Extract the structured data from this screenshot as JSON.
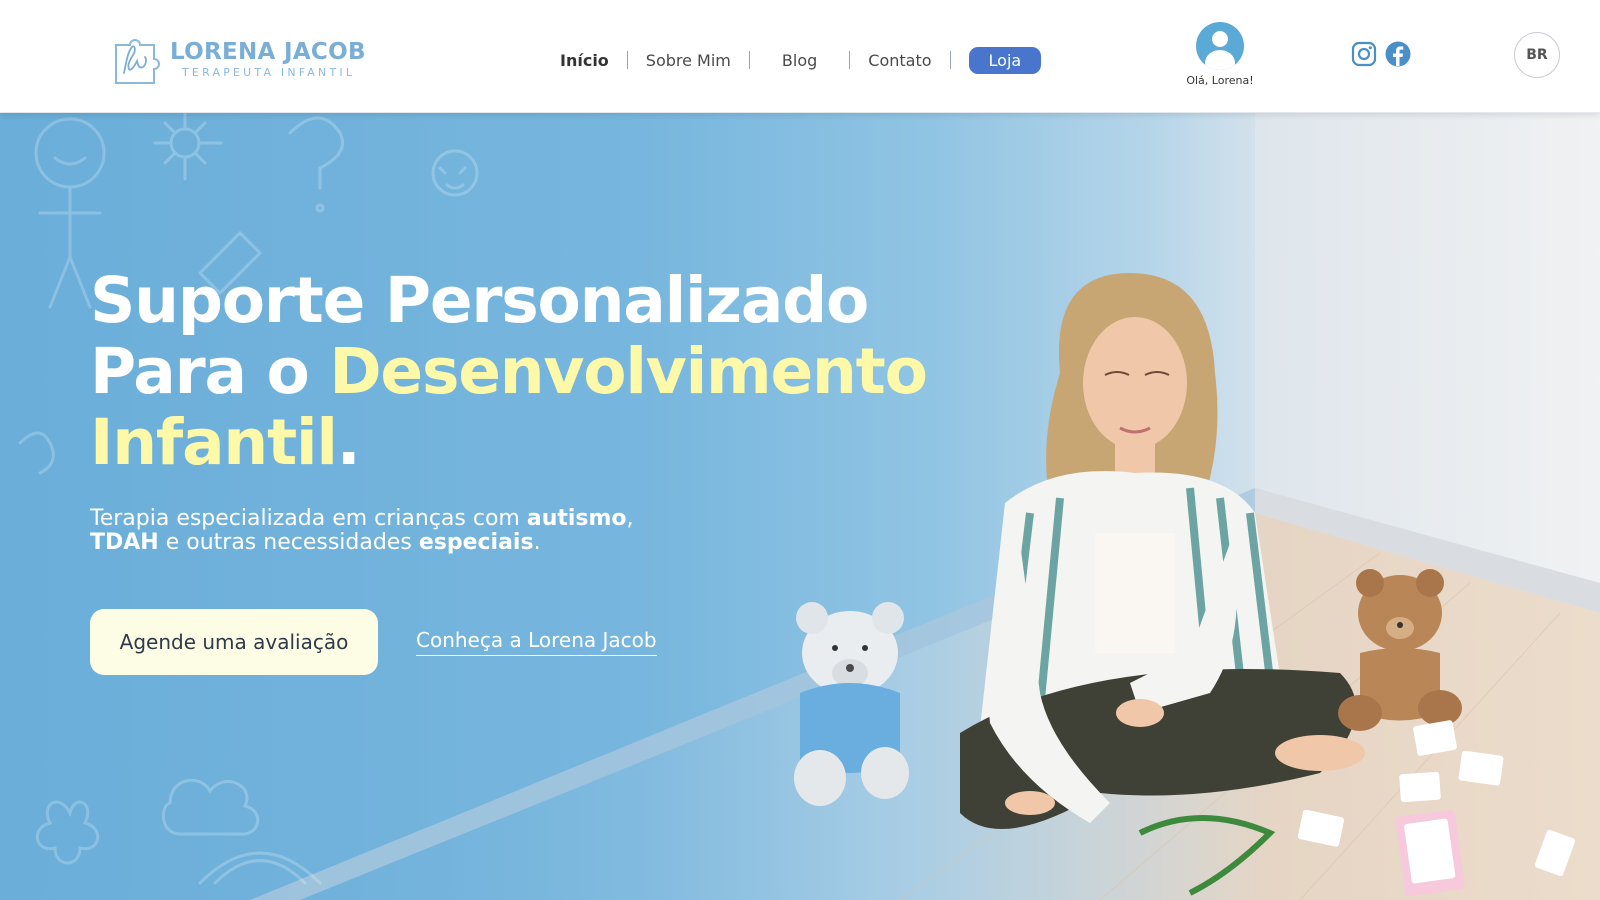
{
  "brand": {
    "name": "LORENA JACOB",
    "tagline": "TERAPEUTA INFANTIL",
    "accent": "#7aaed7"
  },
  "nav": {
    "items": [
      {
        "label": "Início",
        "active": true
      },
      {
        "label": "Sobre Mim",
        "active": false
      },
      {
        "label": "Blog",
        "active": false
      },
      {
        "label": "Contato",
        "active": false
      }
    ],
    "shop_label": "Loja",
    "shop_color": "#4976cc"
  },
  "user": {
    "greeting": "Olá, Lorena!",
    "icon": "user-icon"
  },
  "social": {
    "icons": [
      "instagram-icon",
      "facebook-icon"
    ],
    "color": "#4a8fc7"
  },
  "language": {
    "label": "BR"
  },
  "hero": {
    "title_line1": "Suporte Personalizado",
    "title_line2_a": "Para o ",
    "title_line2_b": "Desenvolvimento",
    "title_line3_a": "Infantil",
    "title_line3_b": ".",
    "subtitle_1": "Terapia especializada em crianças com ",
    "subtitle_2": "autismo",
    "subtitle_3": ",",
    "subtitle_4": "TDAH",
    "subtitle_5": " e outras necessidades ",
    "subtitle_6": "especiais",
    "subtitle_7": ".",
    "highlight_color": "#fdf9a8",
    "cta_primary": "Agende uma avaliação",
    "cta_secondary": "Conheça a Lorena Jacob"
  }
}
